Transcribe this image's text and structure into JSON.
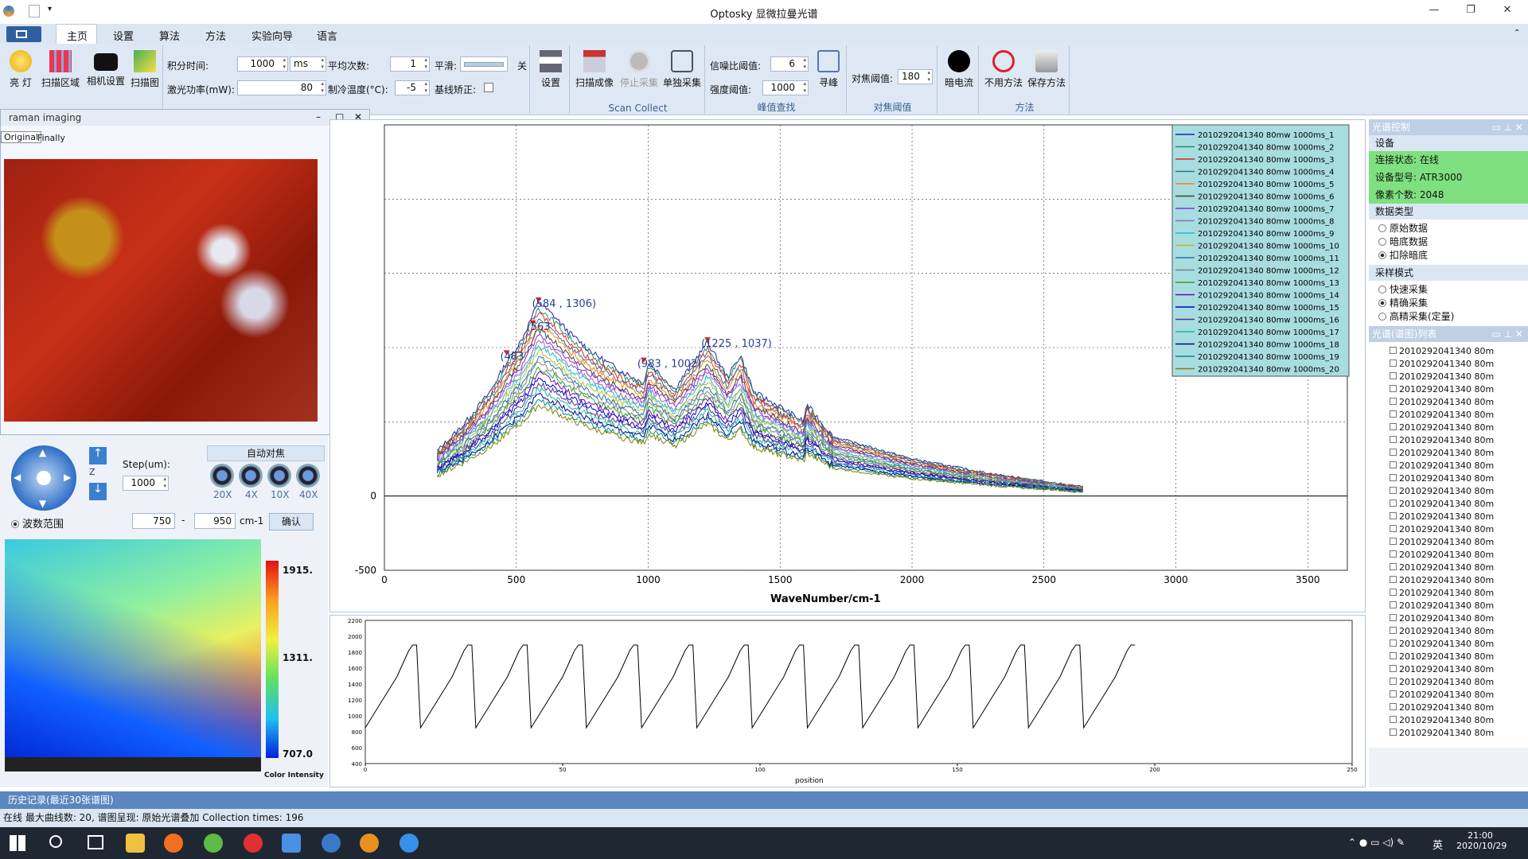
{
  "app": {
    "title": "Optosky 显微拉曼光谱"
  },
  "menu": {
    "items": [
      "主页",
      "设置",
      "算法",
      "方法",
      "实验向导",
      "语言"
    ]
  },
  "ribbon": {
    "light": "亮 灯",
    "scan_area": "扫描区域",
    "camera_settings": "相机设置",
    "scan_image": "扫描图",
    "integration_label": "积分时间:",
    "integration_value": "1000",
    "unit": "ms",
    "laser_label": "激光功率(mW):",
    "laser_value": "80",
    "average_label": "平均次数:",
    "average_value": "1",
    "cooling_label": "制冷温度(°C):",
    "cooling_value": "-5",
    "smooth_label": "平滑:",
    "smooth_state": "关",
    "baseline_label": "基线矫正:",
    "settings": "设置",
    "scan_imaging": "扫描成像",
    "stop_collect": "停止采集",
    "single_collect": "单独采集",
    "scan_collect_group": "Scan Collect",
    "snr_label": "信噪比阈值:",
    "snr_value": "6",
    "intensity_label": "强度阈值:",
    "intensity_value": "1000",
    "peak_search_group": "峰值查找",
    "find_peak": "寻峰",
    "focus_label": "对焦阈值:",
    "focus_value": "180",
    "focus_group": "对焦阈值",
    "dark": "暗电流",
    "disable_method": "不用方法",
    "save_method": "保存方法",
    "method_group": "方法"
  },
  "float_window": {
    "title": "raman imaging",
    "tabs": [
      "Original",
      "Finally"
    ]
  },
  "stage": {
    "step_label": "Step(um):",
    "step_value": "1000",
    "autofocus": "自动对焦",
    "lenses": [
      "20X",
      "4X",
      "10X",
      "40X"
    ]
  },
  "range": {
    "label": "波数范围",
    "from": "750",
    "to": "950",
    "unit": "cm-1",
    "confirm": "确认"
  },
  "heatmap": {
    "ticks": [
      "1915.",
      "1311.",
      "707.0"
    ],
    "caption": "Color Intensity"
  },
  "chart_data": {
    "type": "line",
    "xlabel": "WaveNumber/cm-1",
    "xlim": [
      0,
      3650
    ],
    "ylim": [
      -500,
      2500
    ],
    "xticks": [
      "0",
      "500",
      "1000",
      "1500",
      "2000",
      "2500",
      "3000",
      "3500"
    ],
    "yticks": [
      "-500",
      "0"
    ],
    "peak_labels": [
      "(584 , 1306)",
      "(463",
      "(563",
      "(983 , 1002)",
      "(1225 , 1037)"
    ],
    "legend": [
      "2010292041340 80mw 1000ms_1",
      "2010292041340 80mw 1000ms_2",
      "2010292041340 80mw 1000ms_3",
      "2010292041340 80mw 1000ms_4",
      "2010292041340 80mw 1000ms_5",
      "2010292041340 80mw 1000ms_6",
      "2010292041340 80mw 1000ms_7",
      "2010292041340 80mw 1000ms_8",
      "2010292041340 80mw 1000ms_9",
      "2010292041340 80mw 1000ms_10",
      "2010292041340 80mw 1000ms_11",
      "2010292041340 80mw 1000ms_12",
      "2010292041340 80mw 1000ms_13",
      "2010292041340 80mw 1000ms_14",
      "2010292041340 80mw 1000ms_15",
      "2010292041340 80mw 1000ms_16",
      "2010292041340 80mw 1000ms_17",
      "2010292041340 80mw 1000ms_18",
      "2010292041340 80mw 1000ms_19",
      "2010292041340 80mw 1000ms_20"
    ],
    "colors": [
      "#1f1fb4",
      "#2e8b57",
      "#d62728",
      "#3c6e8f",
      "#ff7f0e",
      "#444444",
      "#8a2be2",
      "#9467bd",
      "#17becf",
      "#bcbd22",
      "#1f77b4",
      "#7f7f7f",
      "#2ca02c",
      "#6a0dad",
      "#0000cd",
      "#483d8b",
      "#20b2aa",
      "#00008b",
      "#008b8b",
      "#808000"
    ],
    "base_spectrum": {
      "x": [
        200,
        300,
        400,
        463,
        520,
        584,
        650,
        700,
        800,
        900,
        983,
        1002,
        1100,
        1225,
        1300,
        1350,
        1400,
        1500,
        1590,
        1600,
        1700,
        2000,
        2300,
        2650
      ],
      "y": [
        300,
        480,
        700,
        900,
        1050,
        1306,
        1200,
        1100,
        950,
        840,
        760,
        900,
        720,
        1037,
        800,
        950,
        700,
        600,
        500,
        620,
        400,
        250,
        150,
        60
      ]
    },
    "position_series": {
      "xlabel": "position",
      "xlim": [
        0,
        250
      ],
      "ylim": [
        400,
        2200
      ],
      "xticks": [
        "0",
        "50",
        "100",
        "150",
        "200",
        "250"
      ],
      "yticks": [
        "2200",
        "2000",
        "1800",
        "1600",
        "1400",
        "1200",
        "1000",
        "800",
        "600",
        "400"
      ]
    }
  },
  "right": {
    "title": "光谱控制",
    "device": "设备",
    "status": "连接状态: 在线",
    "model": "设备型号: ATR3000",
    "pixels": "像素个数: 2048",
    "data_type": "数据类型",
    "dtypes": [
      "原始数据",
      "暗底数据",
      "扣除暗底"
    ],
    "mode": "采样模式",
    "modes": [
      "快速采集",
      "精确采集",
      "高精采集(定量)"
    ],
    "list_title": "光谱(谱图)列表",
    "list_item": "2010292041340 80m"
  },
  "history": "历史记录(最近30张谱图)",
  "status": "在线  最大曲线数: 20, 谱图呈现: 原始光谱叠加  Collection times: 196",
  "clock": {
    "time": "21:00",
    "date": "2020/10/29",
    "ime": "英"
  }
}
